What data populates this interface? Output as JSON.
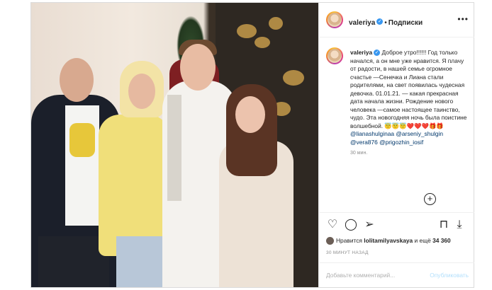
{
  "header": {
    "username": "valeriya",
    "follow_label": "Подписки"
  },
  "caption": {
    "username": "valeriya",
    "text": "Доброе утро!!!!!! Год только начался, а он мне уже нравится. Я плачу от радости, в нашей семье огромное счастье —Сенечка и Лиана стали родителями, на свет появилась чудесная девочка. 01.01.21. — какая прекрасная дата начала жизни. Рождение нового человека —самое настоящее таинство, чудо. Эта новогодняя ночь была поистине волшебной. 😇😇😇❤️❤️❤️🎁🎁",
    "mentions": [
      "@lianashulginaa",
      "@arseniy_shulgin",
      "@vera876",
      "@prigozhin_iosif"
    ],
    "time": "30 мин."
  },
  "likes": {
    "prefix": "Нравится",
    "user": "lolitamilyavskaya",
    "middle": "и ещё",
    "count": "34 360"
  },
  "posted_ago": "30 МИНУТ НАЗАД",
  "comment": {
    "placeholder": "Добавьте комментарий...",
    "publish_label": "Опубликовать"
  },
  "icons": {
    "more": "more-dots-icon",
    "like": "heart-icon",
    "comment": "comment-icon",
    "share": "share-icon",
    "save": "bookmark-icon",
    "download": "download-icon",
    "verified": "verified-badge-icon"
  },
  "colors": {
    "link": "#00376b",
    "verified": "#3897f0",
    "muted": "#8e8e8e",
    "publish_disabled": "#b2dffc"
  }
}
